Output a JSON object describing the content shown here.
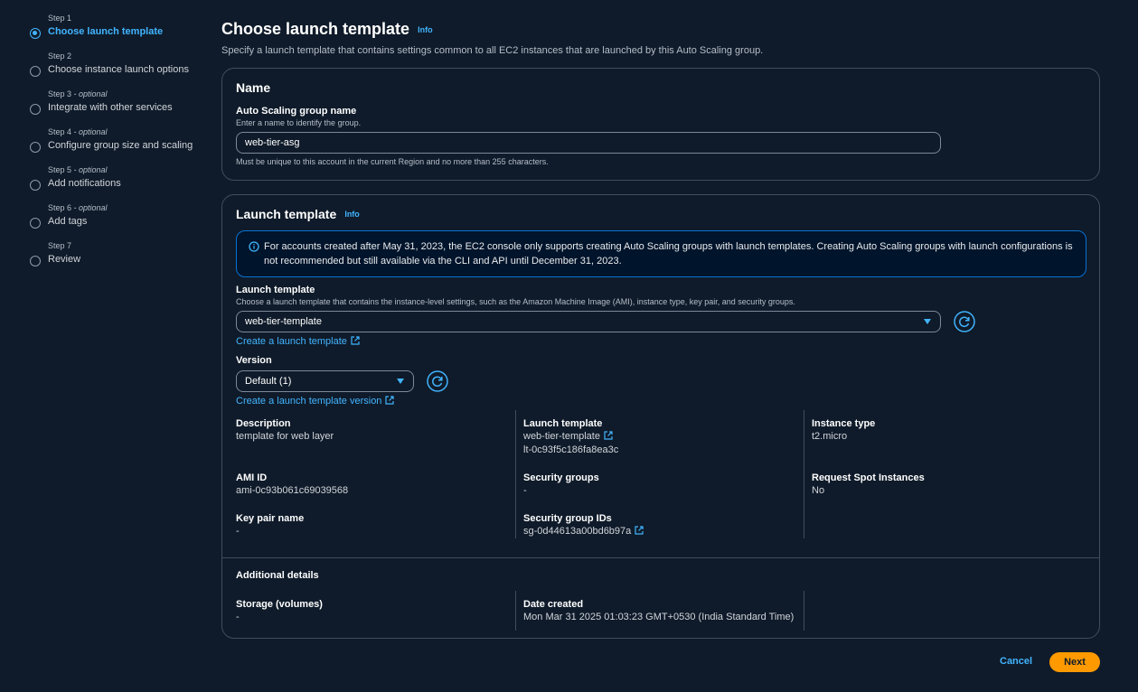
{
  "steps": [
    {
      "num": "Step 1",
      "optional": "",
      "title": "Choose launch template",
      "active": true
    },
    {
      "num": "Step 2",
      "optional": "",
      "title": "Choose instance launch options",
      "active": false
    },
    {
      "num": "Step 3",
      "optional": " - optional",
      "title": "Integrate with other services",
      "active": false
    },
    {
      "num": "Step 4",
      "optional": " - optional",
      "title": "Configure group size and scaling",
      "active": false
    },
    {
      "num": "Step 5",
      "optional": " - optional",
      "title": "Add notifications",
      "active": false
    },
    {
      "num": "Step 6",
      "optional": " - optional",
      "title": "Add tags",
      "active": false
    },
    {
      "num": "Step 7",
      "optional": "",
      "title": "Review",
      "active": false
    }
  ],
  "header": {
    "title": "Choose launch template",
    "info": "Info",
    "description": "Specify a launch template that contains settings common to all EC2 instances that are launched by this Auto Scaling group."
  },
  "name_panel": {
    "heading": "Name",
    "label": "Auto Scaling group name",
    "description": "Enter a name to identify the group.",
    "value": "web-tier-asg",
    "constraint": "Must be unique to this account in the current Region and no more than 255 characters."
  },
  "lt_panel": {
    "heading": "Launch template",
    "info": "Info",
    "alert": "For accounts created after May 31, 2023, the EC2 console only supports creating Auto Scaling groups with launch templates. Creating Auto Scaling groups with launch configurations is not recommended but still available via the CLI and API until December 31, 2023.",
    "template_label": "Launch template",
    "template_desc": "Choose a launch template that contains the instance-level settings, such as the Amazon Machine Image (AMI), instance type, key pair, and security groups.",
    "template_value": "web-tier-template",
    "create_template_link": "Create a launch template",
    "version_label": "Version",
    "version_value": "Default (1)",
    "create_version_link": "Create a launch template version",
    "details": {
      "description_label": "Description",
      "description_value": "template for web layer",
      "lt_label": "Launch template",
      "lt_link": "web-tier-template",
      "lt_id": "lt-0c93f5c186fa8ea3c",
      "instance_type_label": "Instance type",
      "instance_type_value": "t2.micro",
      "ami_label": "AMI ID",
      "ami_value": "ami-0c93b061c69039568",
      "sg_label": "Security groups",
      "sg_value": "-",
      "spot_label": "Request Spot Instances",
      "spot_value": "No",
      "keypair_label": "Key pair name",
      "keypair_value": "-",
      "sg_ids_label": "Security group IDs",
      "sg_ids_link": "sg-0d44613a00bd6b97a"
    },
    "additional": {
      "heading": "Additional details",
      "storage_label": "Storage (volumes)",
      "storage_value": "-",
      "date_label": "Date created",
      "date_value": "Mon Mar 31 2025 01:03:23 GMT+0530 (India Standard Time)"
    }
  },
  "footer": {
    "cancel": "Cancel",
    "next": "Next"
  },
  "colors": {
    "accent": "#42b4ff",
    "primary_button": "#ff9900",
    "background": "#0f1b2a",
    "border": "#414d5c"
  }
}
